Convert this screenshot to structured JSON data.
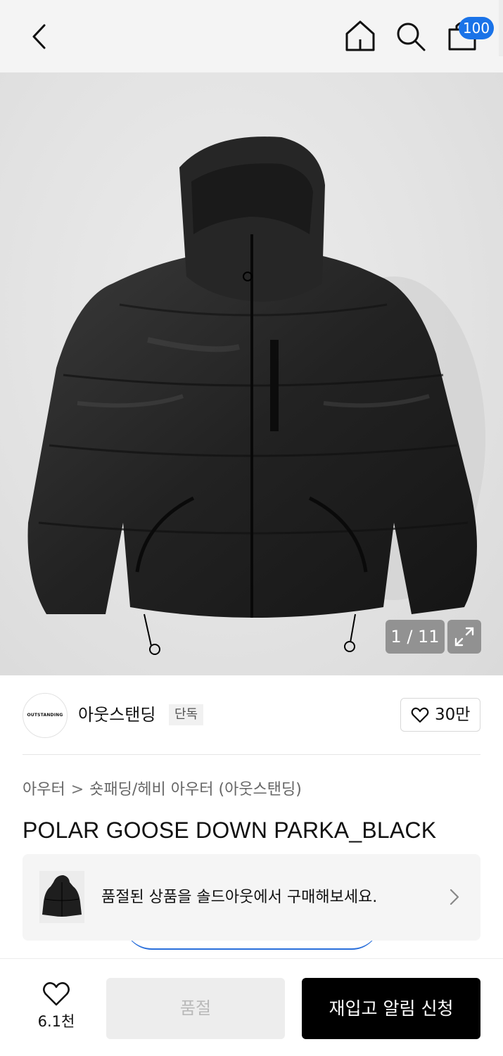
{
  "header": {
    "cart_badge": "100",
    "icons": [
      "chevron-left-icon",
      "home-icon",
      "search-icon",
      "shopping-bag-icon"
    ]
  },
  "gallery": {
    "counter": "1 / 11",
    "expand_icon": "expand-icon"
  },
  "brand": {
    "logo_text": "OUTSTANDING",
    "name": "아웃스탠딩",
    "badge": "단독",
    "like_count": "30만"
  },
  "breadcrumb": {
    "category": "아우터",
    "separator": ">",
    "subcategory": "숏패딩/헤비 아우터 (아웃스탠딩)"
  },
  "product": {
    "title": "POLAR GOOSE DOWN PARKA_BLACK"
  },
  "soldout_banner": {
    "text": "품절된 상품을 솔드아웃에서 구매해보세요."
  },
  "bottom_bar": {
    "wish_count": "6.1천",
    "soldout_label": "품절",
    "restock_label": "재입고 알림 신청"
  },
  "colors": {
    "accent_blue": "#1a73e8",
    "primary_button": "#000000",
    "disabled_button": "#ededed"
  }
}
